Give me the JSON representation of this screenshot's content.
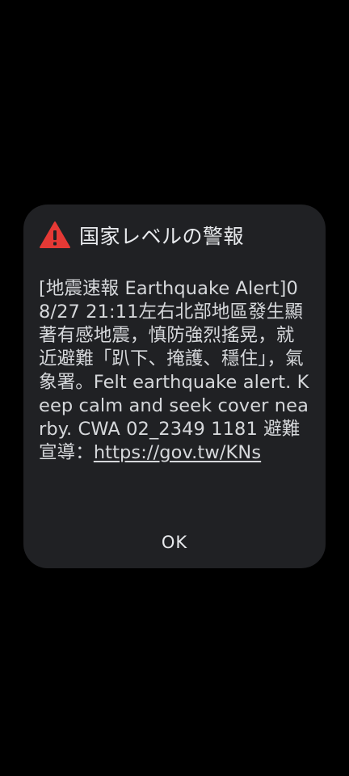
{
  "dialog": {
    "title": "国家レベルの警報",
    "icon": "warning-triangle-icon",
    "icon_color": "#e53935",
    "message": "[地震速報 Earthquake Alert]08/27 21:11左右北部地區發生顯著有感地震，慎防強烈搖晃，就近避難「趴下、掩護、穩住」，氣象署。Felt earthquake alert. Keep calm and seek cover nearby. CWA 02_2349 1181 避難宣導：",
    "link_text": "https://gov.tw/KNs",
    "ok_label": "OK"
  }
}
